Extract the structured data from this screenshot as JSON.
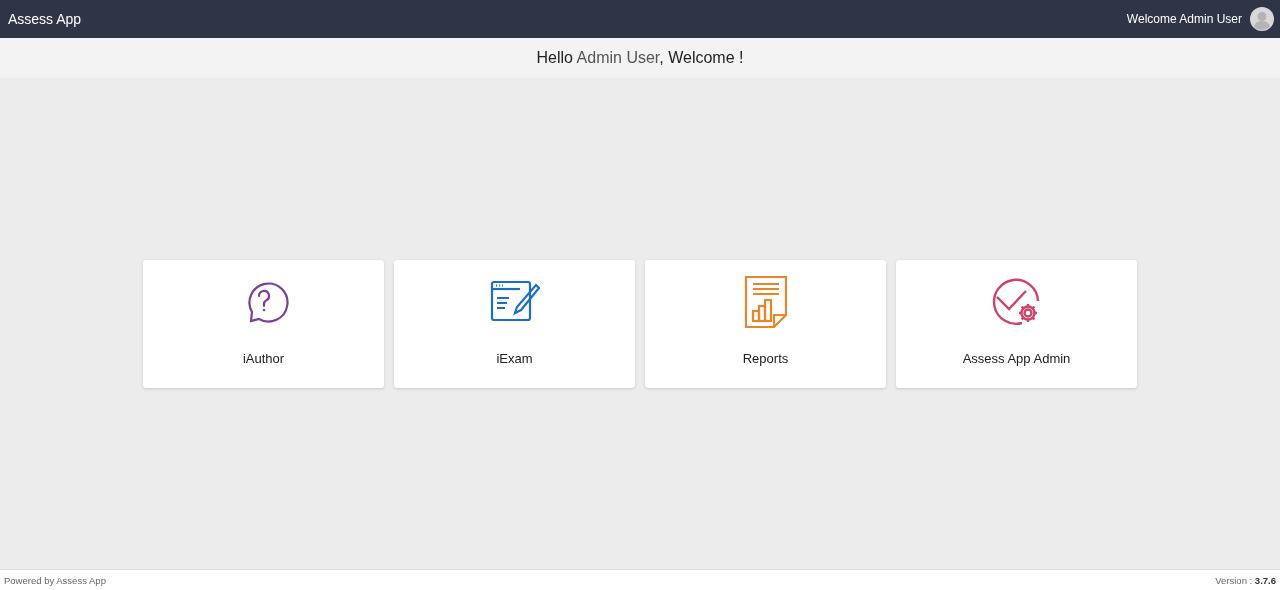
{
  "app_bar": {
    "title": "Assess App",
    "user_label": "Welcome Admin User"
  },
  "greeting": {
    "before": "Hello ",
    "name": "Admin User",
    "after": ", Welcome !"
  },
  "tiles": [
    {
      "kind": "question",
      "label": "iAuthor",
      "color": "#7b3f98"
    },
    {
      "kind": "exam",
      "label": "iExam",
      "color": "#1a6fc9"
    },
    {
      "kind": "report",
      "label": "Reports",
      "color": "#e8862a"
    },
    {
      "kind": "admin",
      "label": "Assess App Admin",
      "color": "#d0426e"
    }
  ],
  "footer": {
    "left": "Powered by Assess App",
    "right": "Version : **3.7.6**"
  }
}
